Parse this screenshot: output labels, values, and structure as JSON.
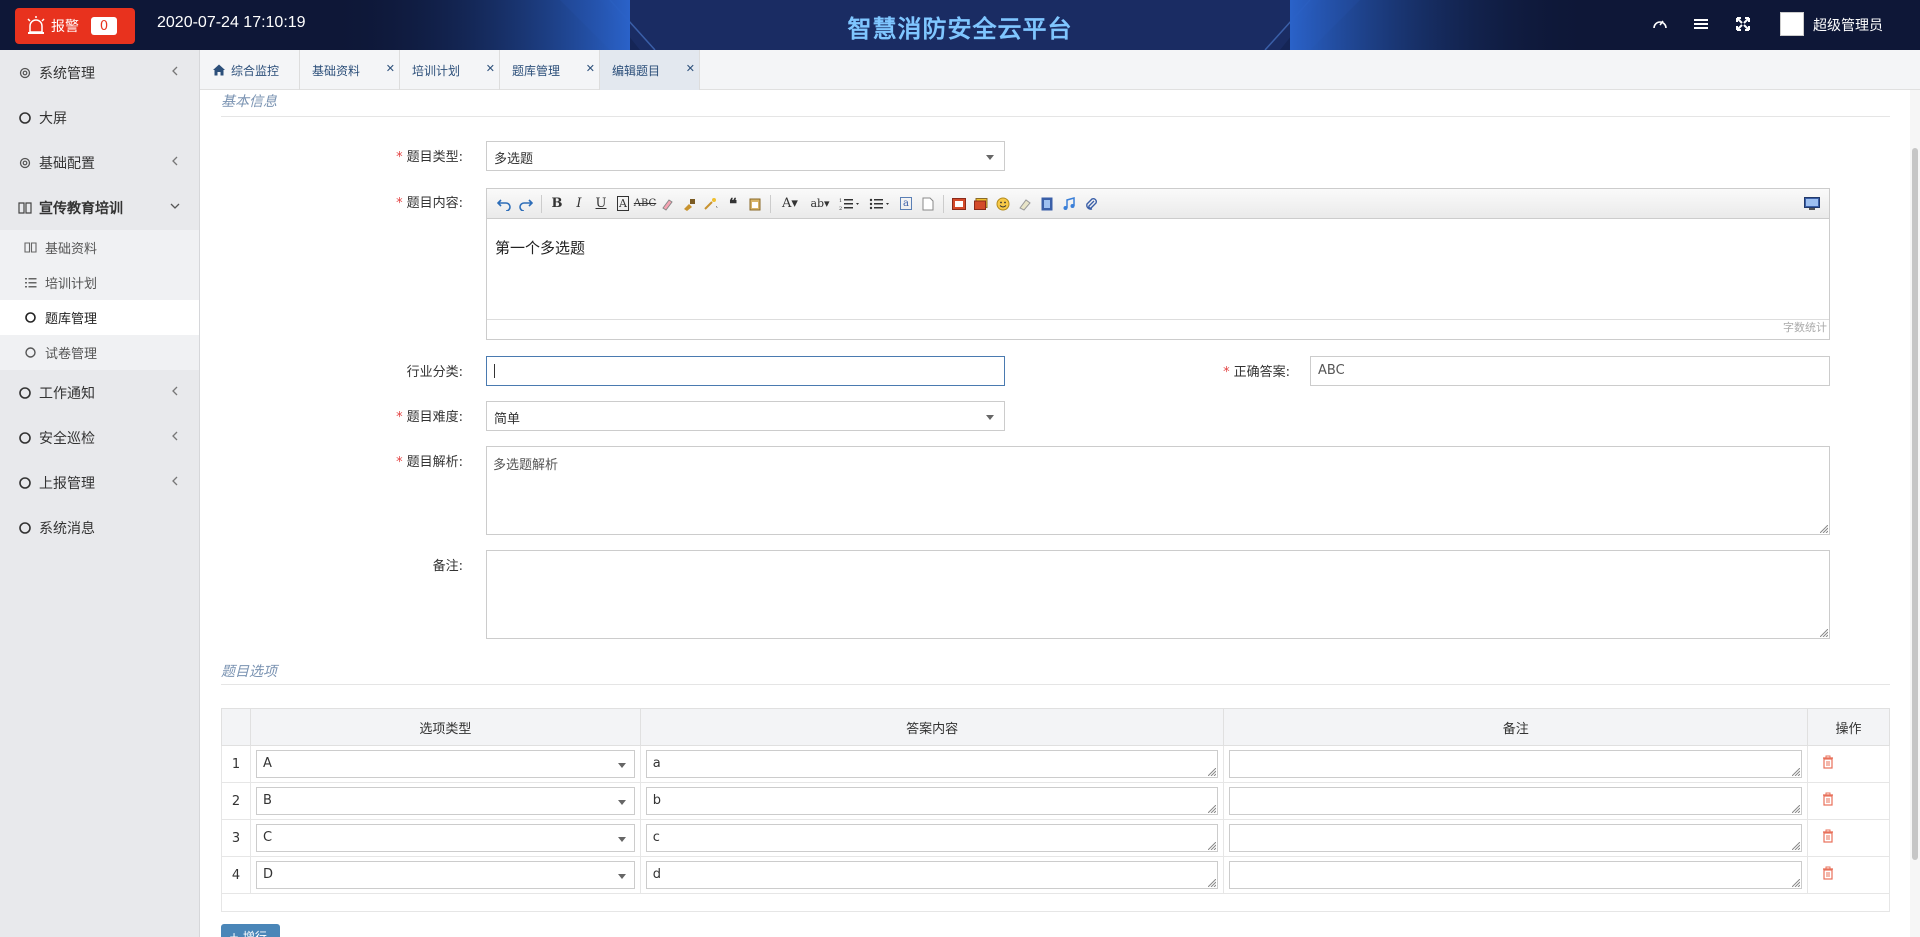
{
  "header": {
    "alarm_label": "报警",
    "alarm_count": "0",
    "datetime": "2020-07-24 17:10:19",
    "title": "智慧消防安全云平台",
    "username": "超级管理员",
    "icons": [
      "dashboard-icon",
      "menu-icon",
      "fullscreen-icon"
    ]
  },
  "sidebar": {
    "items": [
      {
        "label": "系统管理",
        "icon": "gear-icon"
      },
      {
        "label": "大屏",
        "icon": "circle-icon"
      },
      {
        "label": "基础配置",
        "icon": "gear-icon"
      },
      {
        "label": "宣传教育培训",
        "icon": "book-icon"
      },
      {
        "label": "基础资料",
        "icon": "book-icon"
      },
      {
        "label": "培训计划",
        "icon": "list-icon"
      },
      {
        "label": "题库管理",
        "icon": "circle-icon"
      },
      {
        "label": "试卷管理",
        "icon": "circle-icon"
      },
      {
        "label": "工作通知",
        "icon": "circle-icon"
      },
      {
        "label": "安全巡检",
        "icon": "circle-icon"
      },
      {
        "label": "上报管理",
        "icon": "circle-icon"
      },
      {
        "label": "系统消息",
        "icon": "circle-icon"
      }
    ]
  },
  "tabs": [
    {
      "label": "综合监控"
    },
    {
      "label": "基础资料"
    },
    {
      "label": "培训计划"
    },
    {
      "label": "题库管理"
    },
    {
      "label": "编辑题目"
    }
  ],
  "form": {
    "section_basic": "基本信息",
    "type_label": "题目类型:",
    "type_value": "多选题",
    "content_label": "题目内容:",
    "content_value": "第一个多选题",
    "word_count": "字数统计",
    "industry_label": "行业分类:",
    "industry_value": "",
    "answer_label": "正确答案:",
    "answer_value": "ABC",
    "difficulty_label": "题目难度:",
    "difficulty_value": "简单",
    "analysis_label": "题目解析:",
    "analysis_value": "多选题解析",
    "remark_label": "备注:",
    "remark_value": ""
  },
  "options": {
    "section_title": "题目选项",
    "columns": [
      "选项类型",
      "答案内容",
      "备注",
      "操作"
    ],
    "rows": [
      {
        "index": "1",
        "type": "A",
        "content": "a",
        "remark": ""
      },
      {
        "index": "2",
        "type": "B",
        "content": "b",
        "remark": ""
      },
      {
        "index": "3",
        "type": "C",
        "content": "c",
        "remark": ""
      },
      {
        "index": "4",
        "type": "D",
        "content": "d",
        "remark": ""
      }
    ],
    "add_label": "+ 增行"
  },
  "colors": {
    "header_bg": "#0e1737",
    "title": "#7fc6ff",
    "alarm": "#e8321e",
    "required": "#e34242",
    "section": "#7a93b2",
    "delete": "#e8705a"
  }
}
